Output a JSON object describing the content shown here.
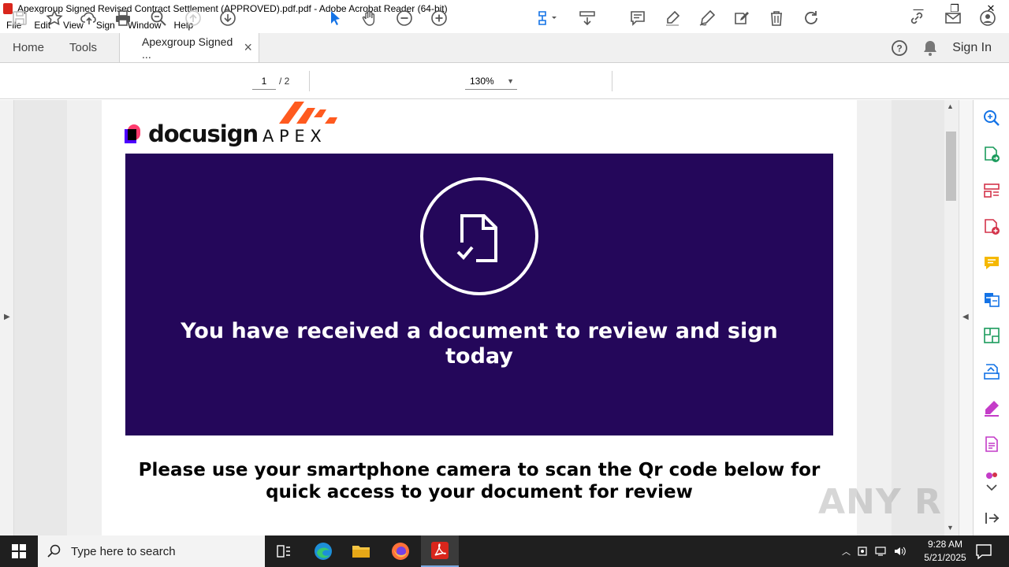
{
  "window": {
    "title": "Apexgroup Signed Revised Contract Settlement (APPROVED).pdf.pdf - Adobe Acrobat Reader (64-bit)",
    "minimize": "—",
    "maximize": "❐",
    "close": "✕"
  },
  "menu": [
    "File",
    "Edit",
    "View",
    "Sign",
    "Window",
    "Help"
  ],
  "tabs": {
    "home": "Home",
    "tools": "Tools",
    "document": "Apexgroup Signed ...",
    "close": "×",
    "sign_in": "Sign In"
  },
  "toolbar": {
    "page_current": "1",
    "page_total": "/ 2",
    "zoom": "130%"
  },
  "document": {
    "logo_docusign": "docusign",
    "logo_apex": "A P E X",
    "banner_title": "You have received a document to review and sign today",
    "scan_text": "Please use your smartphone camera to scan the Qr code below for quick access to your document for review"
  },
  "watermark": "ANY RUN",
  "taskbar": {
    "search_placeholder": "Type here to search",
    "time": "9:28 AM",
    "date": "5/21/2025"
  },
  "colors": {
    "banner": "#24075a",
    "apex_orange": "#ff5a1f",
    "acrobat_red": "#d9261c",
    "panel_blue": "#1473e6"
  }
}
